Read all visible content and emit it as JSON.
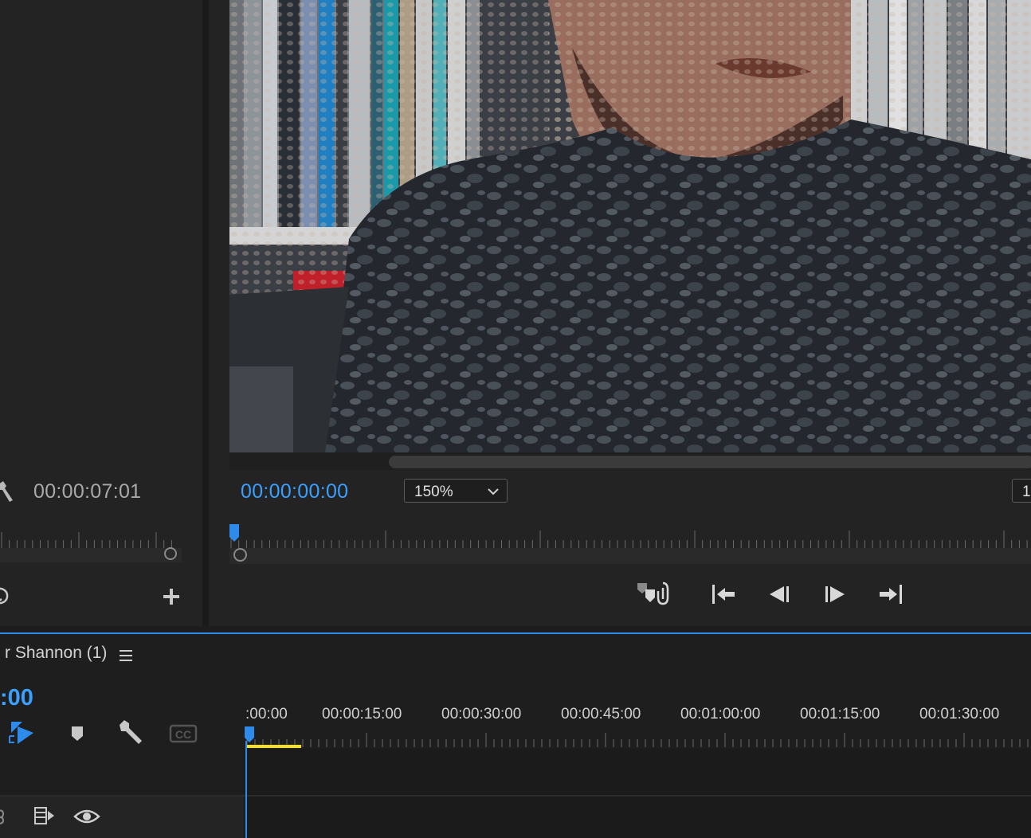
{
  "source_monitor": {
    "timecode": "00:00:07:01"
  },
  "program_monitor": {
    "timecode": "00:00:00:00",
    "zoom_level": "150%",
    "fit_value_partial": "1",
    "transport_buttons": [
      "markers-link",
      "go-to-in",
      "step-back",
      "step-forward",
      "go-to-out"
    ]
  },
  "timeline": {
    "sequence_title": "r Shannon (1)",
    "timecode": ":00",
    "ruler_labels": [
      ":00:00",
      "00:00:15:00",
      "00:00:30:00",
      "00:00:45:00",
      "00:01:00:00",
      "00:01:15:00",
      "00:01:30:00"
    ],
    "captions_label": "CC"
  },
  "colors": {
    "accent_blue": "#3aa0ff",
    "work_area_yellow": "#f0e020",
    "panel_bg": "#232323"
  },
  "icons": [
    "wrench-icon",
    "loop-icon",
    "plus-icon",
    "chevron-down-icon",
    "hamburger-menu-icon",
    "snap-icon",
    "marker-icon",
    "eye-icon",
    "sync-lock-icon"
  ]
}
